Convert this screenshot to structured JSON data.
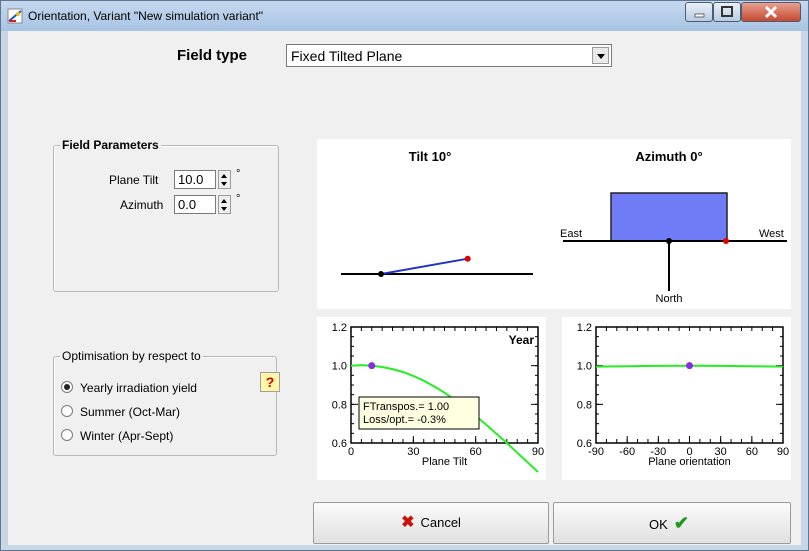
{
  "window": {
    "title": "Orientation, Variant \"New simulation variant\"",
    "icon": "pvsyst-orientation-icon"
  },
  "field_type": {
    "label": "Field type",
    "selected": "Fixed Tilted Plane"
  },
  "field_parameters": {
    "legend": "Field Parameters",
    "plane_tilt_label": "Plane Tilt",
    "plane_tilt_value": "10.0",
    "plane_tilt_unit": "°",
    "azimuth_label": "Azimuth",
    "azimuth_value": "0.0",
    "azimuth_unit": "°"
  },
  "optimisation": {
    "legend": "Optimisation by respect to",
    "options": [
      "Yearly irradiation yield",
      "Summer (Oct-Mar)",
      "Winter (Apr-Sept)"
    ],
    "selected_index": 0,
    "help_label": "?"
  },
  "tilt_diagram": {
    "title": "Tilt 10°",
    "tilt_deg": 10
  },
  "azimuth_diagram": {
    "title": "Azimuth 0°",
    "east_label": "East",
    "west_label": "West",
    "north_label": "North",
    "azimuth_deg": 0
  },
  "chart_data": [
    {
      "type": "line",
      "title": "Year",
      "xlabel": "Plane Tilt",
      "ylabel": "",
      "xlim": [
        0,
        90
      ],
      "ylim": [
        0.6,
        1.2
      ],
      "x_ticks": [
        "0",
        "30",
        "60",
        "90"
      ],
      "y_ticks": [
        "0.6",
        "0.8",
        "1.0",
        "1.2"
      ],
      "series": [
        {
          "x": [
            0,
            5,
            10,
            15,
            20,
            25,
            30,
            35,
            40,
            45,
            50,
            55,
            60,
            65,
            70,
            75,
            80,
            85,
            90
          ],
          "y": [
            1.0,
            1.003,
            1.0,
            0.993,
            0.982,
            0.967,
            0.947,
            0.922,
            0.893,
            0.86,
            0.823,
            0.783,
            0.74,
            0.695,
            0.648,
            0.6,
            0.55,
            0.5,
            0.45
          ]
        }
      ],
      "marker": {
        "x": 10,
        "y": 1.0
      },
      "info_box": [
        "FTranspos.= 1.00",
        "Loss/opt.= -0.3%"
      ]
    },
    {
      "type": "line",
      "title": "",
      "xlabel": "Plane orientation",
      "ylabel": "",
      "xlim": [
        -90,
        90
      ],
      "ylim": [
        0.6,
        1.2
      ],
      "x_ticks": [
        "-90",
        "-60",
        "-30",
        "0",
        "30",
        "60",
        "90"
      ],
      "y_ticks": [
        "0.6",
        "0.8",
        "1.0",
        "1.2"
      ],
      "series": [
        {
          "x": [
            -90,
            -60,
            -30,
            0,
            30,
            60,
            90
          ],
          "y": [
            0.995,
            0.997,
            0.999,
            1.0,
            0.999,
            0.997,
            0.995
          ]
        }
      ],
      "marker": {
        "x": 0,
        "y": 1.0
      }
    }
  ],
  "buttons": {
    "cancel": "Cancel",
    "ok": "OK"
  },
  "colors": {
    "curve": "#22ee22",
    "marker": "#8a2be2",
    "panel_fill": "#6f7cf5",
    "red_point": "#e00000",
    "tilt_line": "#2033c8"
  }
}
